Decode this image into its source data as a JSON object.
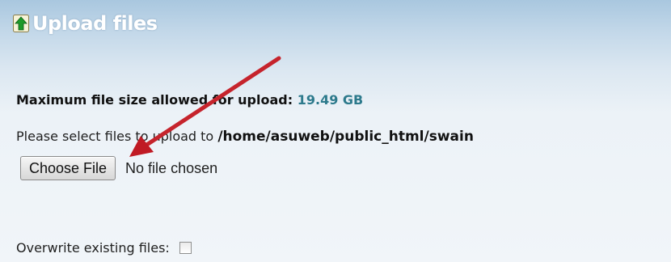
{
  "header": {
    "icon": "upload-arrow-icon",
    "title": "Upload files"
  },
  "max_size": {
    "label": "Maximum file size allowed for upload:",
    "value": "19.49 GB"
  },
  "select": {
    "prefix": "Please select files to upload to",
    "path": "/home/asuweb/public_html/swain"
  },
  "file_input": {
    "button_label": "Choose File",
    "status": "No file chosen"
  },
  "overwrite": {
    "label": "Overwrite existing files:",
    "checked": false
  },
  "annotation": {
    "icon": "red-arrow-icon",
    "color": "#c8202a"
  },
  "colors": {
    "size_value": "#2d7a8c",
    "header_text": "#ffffff",
    "icon_green": "#1e9a2a"
  }
}
